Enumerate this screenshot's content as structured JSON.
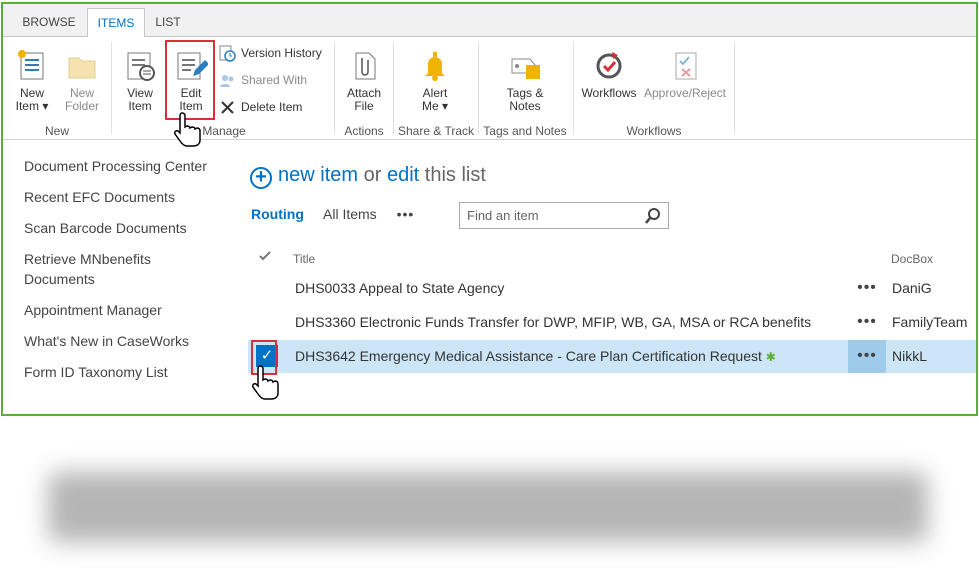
{
  "tabs": [
    "BROWSE",
    "ITEMS",
    "LIST"
  ],
  "ribbon": {
    "new_item": [
      "New",
      "Item ▾"
    ],
    "new_folder": [
      "New",
      "Folder"
    ],
    "view_item": [
      "View",
      "Item"
    ],
    "edit_item": [
      "Edit",
      "Item"
    ],
    "version_history": "Version History",
    "shared_with": "Shared With",
    "delete_item": "Delete Item",
    "attach_file": [
      "Attach",
      "File"
    ],
    "alert_me": [
      "Alert",
      "Me ▾"
    ],
    "tags_notes": [
      "Tags &",
      "Notes"
    ],
    "workflows": "Workflows",
    "approve_reject": "Approve/Reject",
    "groups": {
      "new": "New",
      "manage": "Manage",
      "actions": "Actions",
      "share_track": "Share & Track",
      "tags_notes": "Tags and Notes",
      "workflows": "Workflows"
    }
  },
  "nav": [
    "Document Processing Center",
    "Recent EFC Documents",
    "Scan Barcode Documents",
    "Retrieve MNbenefits Documents",
    "Appointment Manager",
    "What's New in CaseWorks",
    "Form ID Taxonomy List"
  ],
  "headline": {
    "new_item": "new item",
    "or": "or",
    "edit": "edit",
    "this_list": "this list"
  },
  "views": {
    "routing": "Routing",
    "all_items": "All Items",
    "more": "•••"
  },
  "search": {
    "placeholder": "Find an item"
  },
  "columns": {
    "title": "Title",
    "docbox": "DocBox"
  },
  "rows": [
    {
      "title": "DHS0033 Appeal to State Agency",
      "docbox": "DaniG"
    },
    {
      "title": "DHS3360 Electronic Funds Transfer for DWP, MFIP, WB, GA, MSA or RCA benefits",
      "docbox": "FamilyTeam"
    },
    {
      "title": "DHS3642 Emergency Medical Assistance - Care Plan Certification Request",
      "docbox": "NikkL"
    }
  ],
  "row_dots": "•••",
  "colors": {
    "accent": "#0072c6",
    "frame": "#5aae3a",
    "highlight": "#d9303a",
    "selected_row": "#cde6f7"
  }
}
